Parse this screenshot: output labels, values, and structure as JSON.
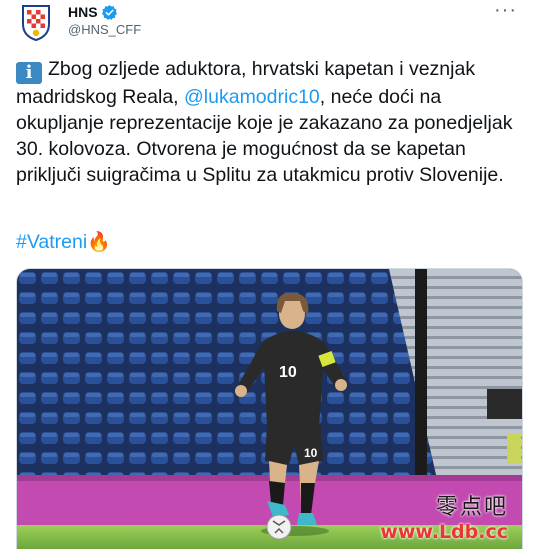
{
  "author": {
    "display_name": "HNS",
    "handle": "@HNS_CFF",
    "avatar_icon": "hns-crest-icon",
    "verified_icon": "verified-badge-icon"
  },
  "menu": {
    "label": "···",
    "icon": "more-options-icon"
  },
  "tweet": {
    "info_emoji": "i",
    "text_part1": "Zbog ozljede aduktora, hrvatski kapetan i vezn­jak madridskog Reala, ",
    "mention": "@lukamodric10",
    "text_part2": ", neće doći na okupljanje reprezentacije koje je zakazano za ponedjeljak 30. kolovoza. Otvorena je mogućnost da se kapetan priključi suigračima u Splitu za utakmicu protiv Slovenije.",
    "hashtag": "#Vatreni",
    "hashtag_emoji": "🔥"
  },
  "media": {
    "player_number": "10",
    "image_icon": "football-photo"
  },
  "watermark": {
    "line1": "零点吧",
    "line2": "www.Ldb.cc"
  },
  "colors": {
    "link": "#1d9bf0",
    "verified": "#1d9bf0",
    "text": "#0f1419",
    "secondary": "#536471"
  }
}
